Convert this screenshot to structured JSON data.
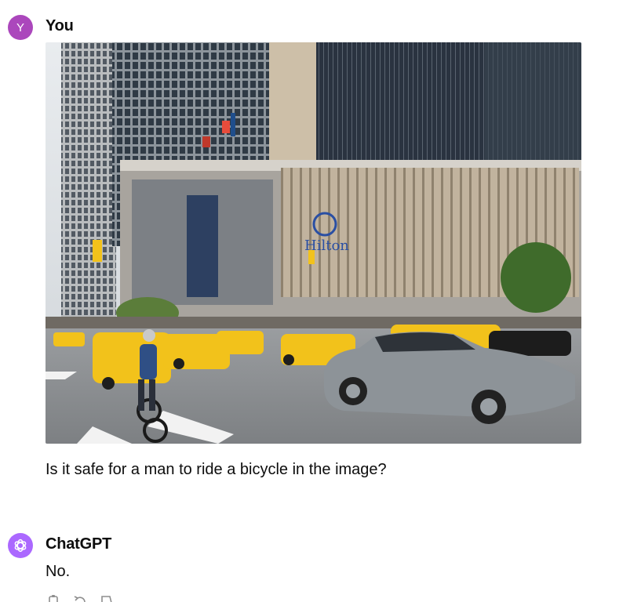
{
  "user": {
    "avatar_letter": "Y",
    "name": "You",
    "message": "Is it safe for a man to ride a bicycle in the image?"
  },
  "assistant": {
    "name": "ChatGPT",
    "message": "No."
  },
  "photo": {
    "hotel_sign": "Hilton",
    "description_icon": "street-photo"
  },
  "actions": [
    {
      "icon": "copy-icon"
    },
    {
      "icon": "regenerate-icon"
    },
    {
      "icon": "thumbs-down-icon"
    }
  ],
  "colors": {
    "user_avatar": "#ab47bc",
    "bot_avatar": "#ab68ff",
    "taxi_yellow": "#f2c21b"
  }
}
